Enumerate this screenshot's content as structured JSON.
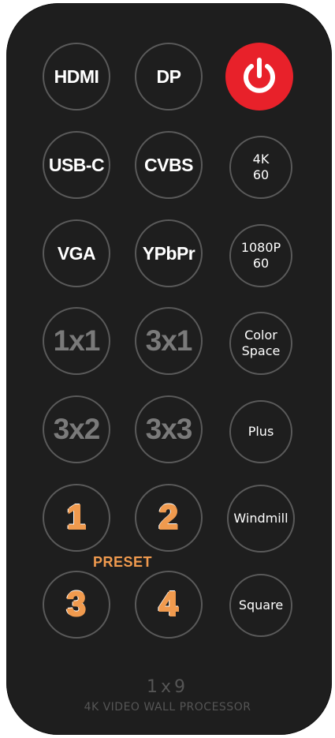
{
  "remote": {
    "colors": {
      "body": "#1e1e1e",
      "button_ring": "#5a5a5a",
      "power_red": "#e8212a",
      "preset_orange": "#f09a4e",
      "layout_gray": "#7a7a7a",
      "footer_gray": "#555555"
    },
    "inputs": {
      "hdmi": "HDMI",
      "dp": "DP",
      "usbc": "USB-C",
      "cvbs": "CVBS",
      "vga": "VGA",
      "ypbpr": "YPbPr"
    },
    "power": {
      "icon": "power-icon"
    },
    "resolutions": {
      "r4k60": "4K\n60",
      "r1080p60": "1080P\n60",
      "color_space": "Color\nSpace"
    },
    "layouts": {
      "l1x1": "1x1",
      "l3x1": "3x1",
      "l3x2": "3x2",
      "l3x3": "3x3"
    },
    "effects": {
      "plus": "Plus",
      "windmill": "Windmill",
      "square": "Square"
    },
    "presets": {
      "title": "PRESET",
      "p1": "1",
      "p2": "2",
      "p3": "3",
      "p4": "4"
    },
    "footer": {
      "model": "1x9",
      "name": "4K VIDEO WALL PROCESSOR"
    }
  }
}
